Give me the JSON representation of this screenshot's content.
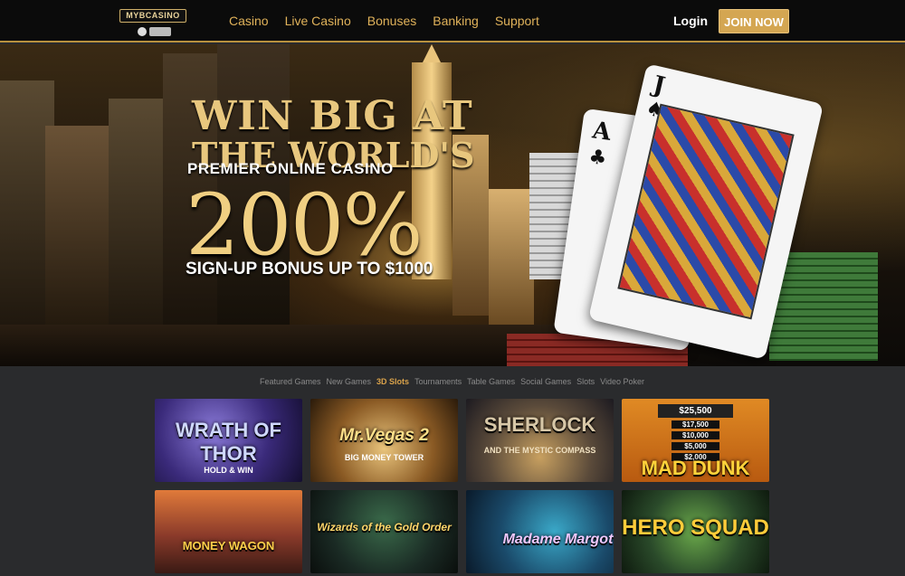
{
  "header": {
    "logo_text": "MYBCASINO",
    "nav": [
      "Casino",
      "Live Casino",
      "Bonuses",
      "Banking",
      "Support"
    ],
    "login": "Login",
    "join": "JOIN NOW"
  },
  "hero": {
    "line1": "WIN BIG AT",
    "line2": "THE WORLD'S",
    "line3": "PREMIER ONLINE CASINO",
    "percent": "200%",
    "bonus": "SIGN-UP BONUS UP TO $1000",
    "card_ace_rank": "A",
    "card_jack_rank": "J"
  },
  "game_tabs": {
    "items": [
      "Featured Games",
      "New Games",
      "3D Slots",
      "Tournaments",
      "Table Games",
      "Social Games",
      "Slots",
      "Video Poker"
    ],
    "active": "3D Slots"
  },
  "games": [
    {
      "title": "WRATH OF THOR",
      "subtitle": "HOLD & WIN"
    },
    {
      "title": "Mr.Vegas 2",
      "subtitle": "BIG MONEY TOWER"
    },
    {
      "title": "SHERLOCK",
      "subtitle": "AND THE MYSTIC COMPASS"
    },
    {
      "title": "MAD DUNK",
      "subtitle": "$25,500",
      "values": [
        "$17,500",
        "$10,000",
        "$5,000",
        "$2,000"
      ]
    },
    {
      "title": "MONEY WAGON",
      "subtitle": ""
    },
    {
      "title": "Wizards of the Gold Order",
      "subtitle": ""
    },
    {
      "title": "Madame Margot",
      "subtitle": ""
    },
    {
      "title": "HERO SQUAD",
      "subtitle": ""
    }
  ],
  "colors": {
    "accent": "#d4a652",
    "nav_text": "#e0b25a",
    "topbar": "#0b0b0b",
    "page_bg": "#2a2b2d"
  }
}
